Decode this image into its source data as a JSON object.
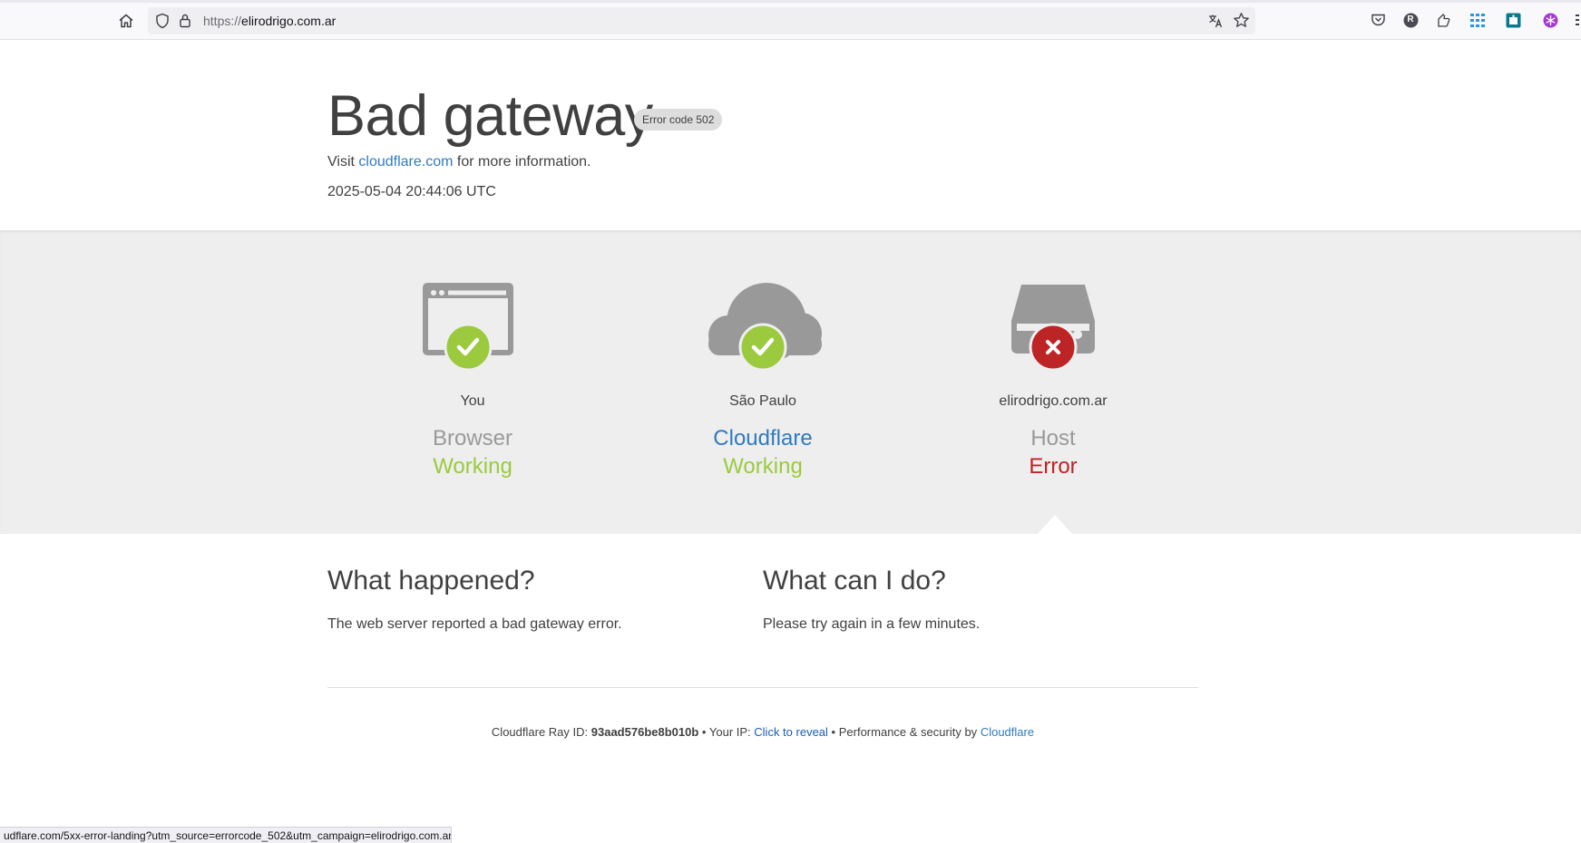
{
  "browser": {
    "url_scheme": "https://",
    "url_host": "elirodrigo.com.ar",
    "status_url": "udflare.com/5xx-error-landing?utm_source=errorcode_502&utm_campaign=elirodrigo.com.ar",
    "extension_r_label": "R"
  },
  "header": {
    "title": "Bad gateway",
    "error_badge": "Error code 502",
    "visit_prefix": "Visit",
    "visit_link": "cloudflare.com",
    "visit_suffix": "for more information.",
    "timestamp": "2025-05-04 20:44:06 UTC"
  },
  "status": {
    "browser": {
      "location": "You",
      "kind": "Browser",
      "state": "Working"
    },
    "cloudflare": {
      "location": "São Paulo",
      "kind": "Cloudflare",
      "state": "Working"
    },
    "host": {
      "location": "elirodrigo.com.ar",
      "kind": "Host",
      "state": "Error"
    }
  },
  "what_happened": {
    "heading": "What happened?",
    "text": "The web server reported a bad gateway error."
  },
  "what_can_i_do": {
    "heading": "What can I do?",
    "text": "Please try again in a few minutes."
  },
  "footer": {
    "ray_label": "Cloudflare Ray ID:",
    "ray_id": "93aad576be8b010b",
    "sep1": "•",
    "ip_label": "Your IP:",
    "ip_link": "Click to reveal",
    "sep2": "•",
    "perf_label": "Performance & security by",
    "perf_link": "Cloudflare"
  },
  "colors": {
    "working": "#9bca3e",
    "error": "#bd2426",
    "link": "#2f7bbf",
    "icon_gray": "#999999",
    "band": "#eeeeee"
  },
  "icons": [
    "home-icon",
    "shield-icon",
    "lock-icon",
    "translate-icon",
    "star-icon",
    "pocket-icon",
    "profile-r-icon",
    "extensions-icon",
    "apps-grid-icon",
    "teal-extension-icon",
    "purple-extension-icon",
    "menu-icon",
    "browser-window-icon",
    "cloud-icon",
    "server-icon",
    "check-icon",
    "cross-icon"
  ]
}
